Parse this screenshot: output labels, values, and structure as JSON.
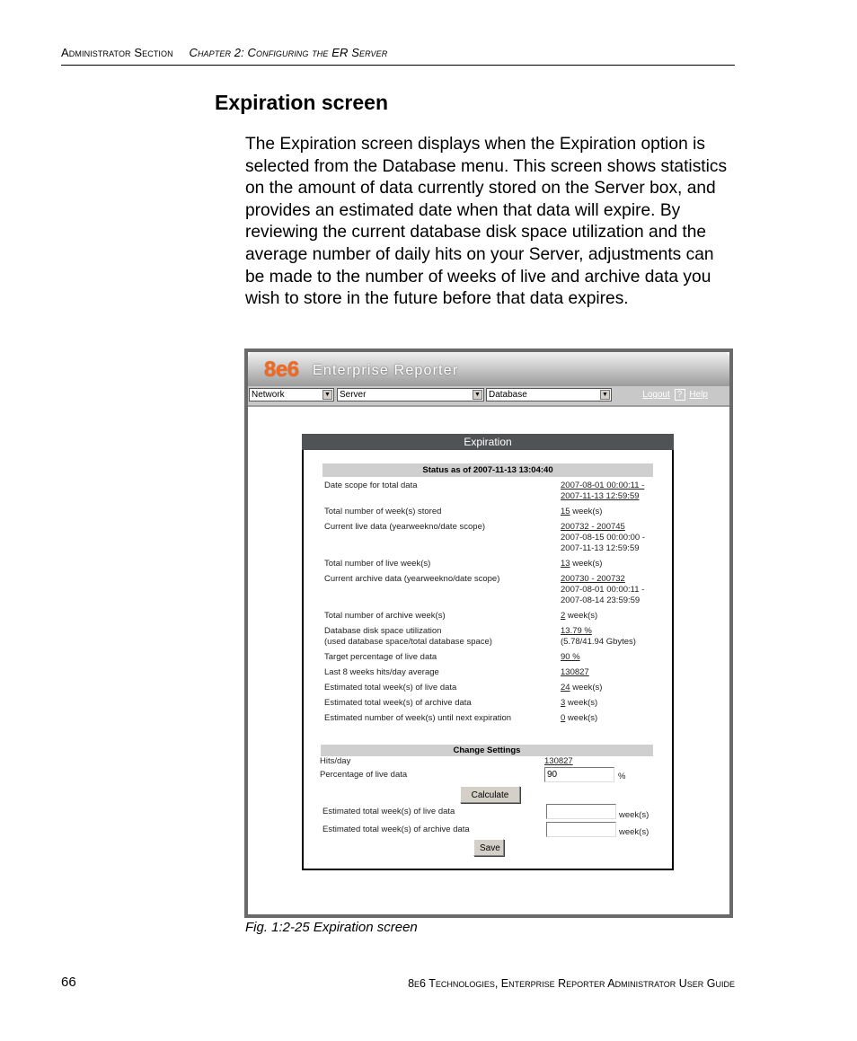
{
  "running_head": {
    "section": "Administrator Section",
    "chapter": "Chapter 2: Configuring the ER Server"
  },
  "page_title": "Expiration screen",
  "body_paragraph": "The Expiration screen displays when the Expiration option is selected from the Database menu. This screen shows statistics on the amount of data currently stored on the Server box, and provides an estimated date when that data will expire. By reviewing the current database disk space utilization and the average number of daily hits on your Server, adjustments can be made to the number of weeks of live and archive data you wish to store in the future before that data expires.",
  "figure": {
    "app": {
      "logo": "8e6",
      "product_name": "Enterprise Reporter",
      "brand_color": "#f26a1b",
      "nav": {
        "menus": [
          {
            "selected": "Network"
          },
          {
            "selected": "Server"
          },
          {
            "selected": "Database"
          }
        ],
        "logout_label": "Logout",
        "help_icon": "?",
        "help_label": "Help"
      },
      "panel": {
        "title": "Expiration",
        "status_header": "Status as of 2007-11-13 13:04:40",
        "stats": [
          {
            "label": "Date scope for total data",
            "value_link": "2007-08-01 00:00:11 -",
            "value_link2": "2007-11-13 12:59:59",
            "value_extra": ""
          },
          {
            "label": "Total number of week(s) stored",
            "value_link": "15",
            "value_suffix": " week(s)"
          },
          {
            "label": "Current live data (yearweekno/date scope)",
            "value_link": "200732 - 200745",
            "value_line2": "2007-08-15 00:00:00 -",
            "value_line3": "2007-11-13 12:59:59"
          },
          {
            "label": "Total number of live week(s)",
            "value_link": "13",
            "value_suffix": " week(s)"
          },
          {
            "label": "Current archive data (yearweekno/date scope)",
            "value_link": "200730 - 200732",
            "value_line2": "2007-08-01 00:00:11 -",
            "value_line3": "2007-08-14 23:59:59"
          },
          {
            "label": "Total number of archive week(s)",
            "value_link": "2",
            "value_suffix": " week(s)"
          },
          {
            "label": "Database disk space utilization",
            "label_line2": "(used database space/total database space)",
            "value_link": "13.79 %",
            "value_line2": "(5.78/41.94 Gbytes)"
          },
          {
            "label": "Target percentage of live data",
            "value_link": "90 %"
          },
          {
            "label": "Last 8 weeks hits/day average",
            "value_link": "130827"
          },
          {
            "label": "Estimated total week(s) of live data",
            "value_link": "24",
            "value_suffix": " week(s)"
          },
          {
            "label": "Estimated total week(s) of archive data",
            "value_link": "3",
            "value_suffix": " week(s)"
          },
          {
            "label": "Estimated number of week(s) until next expiration",
            "value_link": "0",
            "value_suffix": " week(s)"
          }
        ],
        "settings": {
          "header": "Change Settings",
          "hits_label": "Hits/day",
          "hits_value": "130827",
          "percentage_label": "Percentage of live data",
          "percentage_value": "90",
          "percentage_unit": "%",
          "calculate_label": "Calculate",
          "live_weeks_label": "Estimated total week(s) of live data",
          "live_weeks_value": "",
          "archive_weeks_label": "Estimated total week(s) of archive data",
          "archive_weeks_value": "",
          "weeks_unit": "week(s)",
          "save_label": "Save"
        }
      }
    },
    "caption": "Fig. 1:2-25  Expiration screen"
  },
  "footer": {
    "page_number": "66",
    "guide_title": "8e6 Technologies, Enterprise Reporter Administrator User Guide"
  }
}
